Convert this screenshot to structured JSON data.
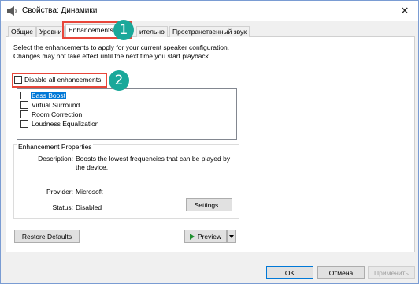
{
  "window": {
    "title": "Свойства: Динамики",
    "close_glyph": "✕"
  },
  "tabs": [
    {
      "label": "Общие"
    },
    {
      "label": "Уровни"
    },
    {
      "label": "Enhancements"
    },
    {
      "label": "ительно"
    },
    {
      "label": "Пространственный звук"
    }
  ],
  "enhancements": {
    "description": "Select the enhancements to apply for your current speaker configuration. Changes may not take effect until the next time you start playback.",
    "disable_all_label": "Disable all enhancements",
    "items": [
      {
        "label": "Bass Boost",
        "checked": false,
        "selected": true
      },
      {
        "label": "Virtual Surround",
        "checked": false,
        "selected": false
      },
      {
        "label": "Room Correction",
        "checked": false,
        "selected": false
      },
      {
        "label": "Loudness Equalization",
        "checked": false,
        "selected": false
      }
    ]
  },
  "properties": {
    "group_title": "Enhancement Properties",
    "description_label": "Description:",
    "description_value": "Boosts the lowest frequencies that can be played by the device.",
    "provider_label": "Provider:",
    "provider_value": "Microsoft",
    "status_label": "Status:",
    "status_value": "Disabled",
    "settings_button": "Settings..."
  },
  "buttons": {
    "restore_defaults": "Restore Defaults",
    "preview": "Preview",
    "ok": "OK",
    "cancel": "Отмена",
    "apply": "Применить"
  },
  "annotations": {
    "badge1": "1",
    "badge2": "2",
    "highlight_color": "#e8463a",
    "badge_color": "#1aa89a"
  },
  "colors": {
    "selection": "#0078d7",
    "preview_play": "#1f8f2f"
  }
}
